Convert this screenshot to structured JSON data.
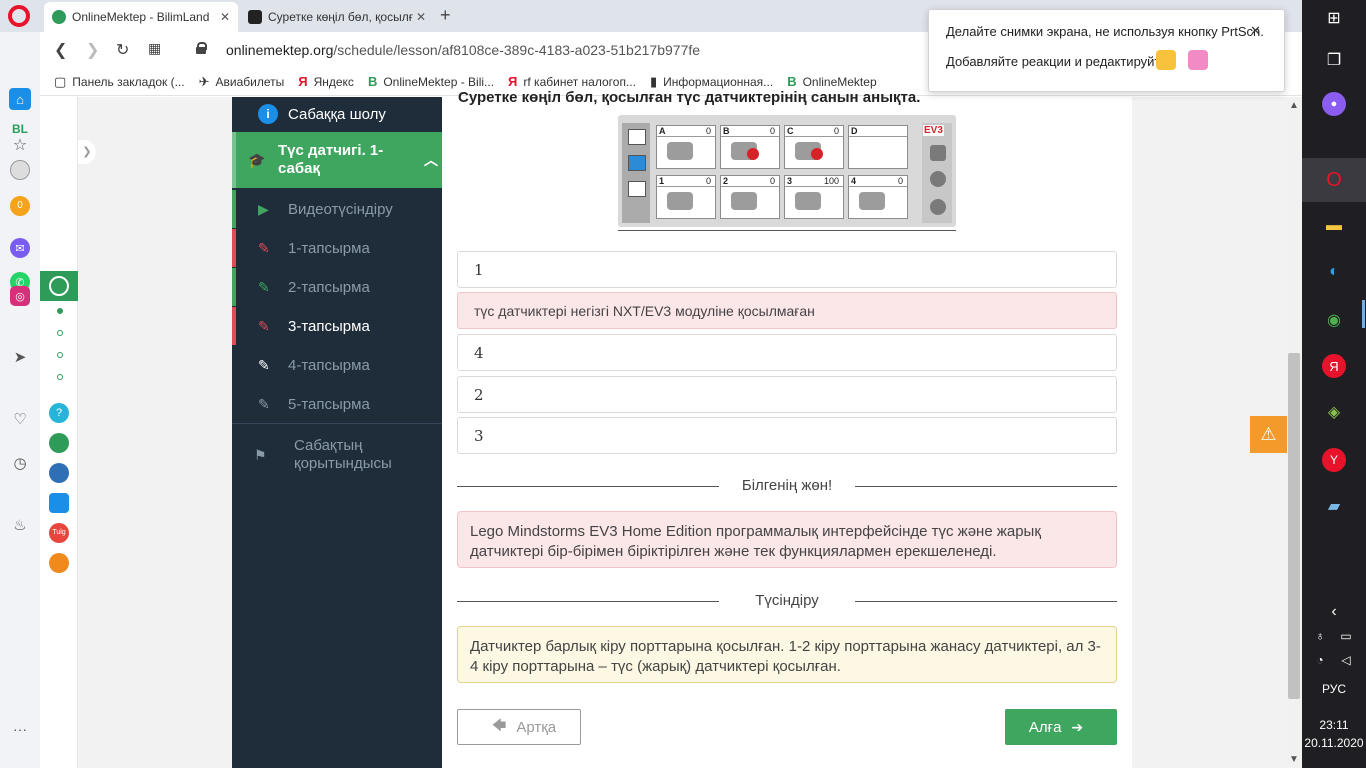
{
  "browser": {
    "tabs": [
      {
        "title": "OnlineMektep - BilimLand",
        "close": "✕"
      },
      {
        "title": "Суретке көңіл бөл, қосылғ",
        "close": "✕"
      }
    ],
    "new_tab": "+",
    "url_host": "onlinemektep.org",
    "url_path": "/schedule/lesson/af8108ce-389c-4183-a023-51b217b977fe",
    "bookmarks": [
      {
        "icon": "▢",
        "label": "Панель закладок (..."
      },
      {
        "icon": "✈",
        "label": "Авиабилеты"
      },
      {
        "icon": "Я",
        "label": "Яндекс"
      },
      {
        "icon": "B",
        "label": "OnlineMektep - Bili..."
      },
      {
        "icon": "Я",
        "label": "rf кабинет налогоп..."
      },
      {
        "icon": "▮",
        "label": "Информационная..."
      },
      {
        "icon": "B",
        "label": "OnlineMektep"
      }
    ]
  },
  "opera_sidebar": {
    "bl_label": "BL",
    "badge_count": "0",
    "icons": [
      "home-icon",
      "star-icon",
      "messenger-icon",
      "whatsapp-icon",
      "instagram-icon",
      "send-icon",
      "heart-icon",
      "clock-icon",
      "bulb-icon",
      "more-icon"
    ],
    "app_labels": [
      "?",
      "",
      "",
      "",
      "Tulg",
      ""
    ]
  },
  "popup": {
    "line1": "Делайте снимки экрана, не используя кнопку PrtScn.",
    "line2": "Добавляйте реакции и редактируйте",
    "close": "✕"
  },
  "lesson_nav": {
    "overview": "Сабаққа шолу",
    "current_lesson": "Түс датчигі. 1-сабақ",
    "items": [
      {
        "label": "Видеотүсіндіру",
        "icon": "play-icon"
      },
      {
        "label": "1-тапсырма",
        "icon": "edit-icon"
      },
      {
        "label": "2-тапсырма",
        "icon": "edit-icon"
      },
      {
        "label": "3-тапсырма",
        "icon": "edit-icon"
      },
      {
        "label": "4-тапсырма",
        "icon": "edit-icon"
      },
      {
        "label": "5-тапсырма",
        "icon": "edit-icon"
      }
    ],
    "conclusion": "Сабақтың қорытындысы"
  },
  "question": {
    "title": "Суретке көңіл бөл, қосылған түс датчиктерінің санын анықта.",
    "ev3": {
      "brand": "EV3",
      "top_ports": [
        {
          "label": "A",
          "value": "0"
        },
        {
          "label": "B",
          "value": "0"
        },
        {
          "label": "C",
          "value": "0"
        },
        {
          "label": "D",
          "value": ""
        }
      ],
      "bottom_ports": [
        {
          "label": "1",
          "value": "0"
        },
        {
          "label": "2",
          "value": "0"
        },
        {
          "label": "3",
          "value": "100"
        },
        {
          "label": "4",
          "value": "0"
        }
      ]
    },
    "answers": [
      {
        "text": "1",
        "state": "normal"
      },
      {
        "text": "түс датчиктері негізгі NXT/EV3 модуліне қосылмаған",
        "state": "wrong"
      },
      {
        "text": "4",
        "state": "normal"
      },
      {
        "text": "2",
        "state": "normal"
      },
      {
        "text": "3",
        "state": "normal"
      }
    ]
  },
  "feedback": {
    "did_you_know_title": "Білгенің жөн!",
    "did_you_know_text": "Lego Mindstorms EV3 Home Edition программалық интерфейсінде түс және жарық датчиктері бір-бірімен біріктірілген және тек функциялармен ерекшеленеді.",
    "explanation_title": "Түсіндіру",
    "explanation_text": "Датчиктер барлық кіру порттарына қосылған. 1-2 кіру порттарына жанасу датчиктері, ал 3-4 кіру порттарына – түс (жарық) датчиктері қосылған."
  },
  "buttons": {
    "back": "Артқа",
    "next": "Алға"
  },
  "taskbar": {
    "language": "РУС",
    "time": "23:11",
    "date": "20.11.2020"
  },
  "colors": {
    "accent_green": "#3fa660",
    "nav_dark": "#1f2d3a",
    "warning_orange": "#f49a2a",
    "error_pink": "#fbe6e8"
  }
}
